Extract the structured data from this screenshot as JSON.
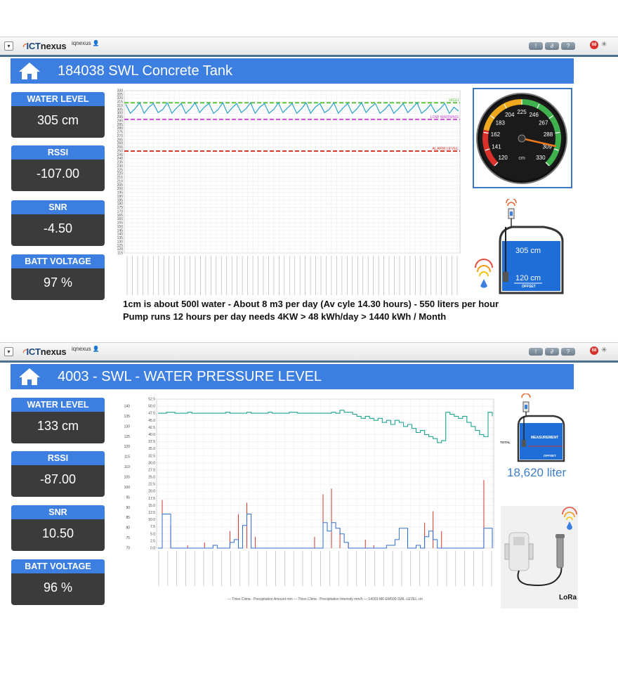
{
  "colors": {
    "accent": "#3d7fe0",
    "card_value_bg": "#3b3b3b",
    "toolbar_rule": "#4a6f8f",
    "high_line": "#5cc63f",
    "low_warning_line": "#c94cd1",
    "alarm_line": "#d93a2e",
    "level_series": "#2aa3c9",
    "teal_series": "#1fa590",
    "precip_amount": "#d23a2e",
    "precip_intensity": "#2e6fd1",
    "badge": "#d9302a"
  },
  "toolbar": {
    "logo_prefix": "ICT",
    "logo_suffix": "nexus",
    "username": "iqnexus",
    "dropdown_icon": "chevron-down-icon",
    "user_icon": "user-icon",
    "buttons": [
      {
        "label": "!",
        "icon": "alert-icon"
      },
      {
        "label": "",
        "icon": "link-icon"
      },
      {
        "label": "?",
        "icon": "help-icon"
      }
    ],
    "badge_count": "68",
    "spark_icon": "sparkle-icon"
  },
  "panel1": {
    "title": "184038 SWL Concrete Tank",
    "home_icon": "home-icon",
    "cards": [
      {
        "label": "WATER LEVEL",
        "value": "305 cm"
      },
      {
        "label": "RSSI",
        "value": "-107.00"
      },
      {
        "label": "SNR",
        "value": "-4.50"
      },
      {
        "label": "BATT VOLTAGE",
        "value": "97 %"
      }
    ],
    "note_line1": "1cm is about 500l water - About 8 m3 per day (Av cyle 14.30 hours) - 550 liters per hour",
    "note_line2": "Pump runs 12 hours per day needs 4KW > 48 kWh/day > 1440 kWh / Month",
    "gauge": {
      "value": 305,
      "min": 120,
      "max": 330,
      "unit": "cm",
      "ticks": [
        "120",
        "141",
        "162",
        "183",
        "204",
        "225",
        "246",
        "267",
        "288",
        "309",
        "330"
      ]
    },
    "tank": {
      "level_label": "305 cm",
      "offset_label": "120 cm",
      "offset_caption": "OFFSET"
    }
  },
  "chart_data": [
    {
      "type": "line",
      "yticks": [
        "115",
        "120",
        "125",
        "130",
        "135",
        "140",
        "145",
        "150",
        "155",
        "160",
        "165",
        "170",
        "175",
        "180",
        "185",
        "190",
        "195",
        "200",
        "205",
        "210",
        "215",
        "220",
        "225",
        "230",
        "235",
        "240",
        "245",
        "250",
        "255",
        "260",
        "265",
        "270",
        "275",
        "280",
        "285",
        "290",
        "295",
        "300",
        "305",
        "310",
        "315",
        "320",
        "325",
        "330"
      ],
      "ylim": [
        115,
        330
      ],
      "series": [
        {
          "name": "HIGH",
          "values": [
            314,
            314
          ]
        },
        {
          "name": "LOW WARNING",
          "values": [
            292,
            292
          ]
        },
        {
          "name": "ALARM LEVEL",
          "values": [
            250,
            250
          ]
        },
        {
          "values": [
            312,
            300,
            306,
            314,
            300,
            308,
            313,
            301,
            305,
            314,
            300,
            307,
            313,
            300,
            306,
            314,
            301,
            308,
            313,
            300,
            305,
            314,
            300,
            307,
            313,
            301,
            306,
            314,
            300,
            308,
            313,
            300,
            305,
            314,
            301,
            307,
            313,
            300,
            306,
            314,
            300,
            308,
            313,
            301,
            305,
            314,
            300,
            307,
            313,
            300,
            306,
            314,
            301,
            308,
            313,
            300,
            305,
            312,
            300,
            306,
            313,
            301,
            307,
            314,
            300,
            305,
            312,
            301,
            306,
            313,
            300,
            308,
            303
          ]
        }
      ],
      "grid": true,
      "xlabels_count": 64
    },
    {
      "type": "line",
      "legend": "— Thies Clima - Precipitation Amount mm  — Thies Clima - Precipitation Intensity mm/h  — 14003-M6-EM500-SWL-LEVEL cm",
      "y_left_ticks": [
        "70",
        "75",
        "80",
        "85",
        "90",
        "95",
        "100",
        "105",
        "110",
        "115",
        "120",
        "125",
        "130",
        "135",
        "140"
      ],
      "y_right_ticks": [
        "0.0",
        "2.5",
        "5.0",
        "7.5",
        "10.0",
        "12.5",
        "15.0",
        "17.5",
        "20.0",
        "22.5",
        "25.0",
        "27.5",
        "30.0",
        "32.5",
        "35.0",
        "37.5",
        "40.0",
        "42.5",
        "45.0",
        "47.5",
        "50.0",
        "52.5"
      ],
      "series": [
        {
          "name": "14003-M6-EM500-SWL-LEVEL cm",
          "values": [
            136.5,
            136.5,
            137,
            137,
            136.5,
            136.5,
            136.5,
            137,
            136.5,
            136.5,
            136.5,
            136.5,
            136.5,
            136.5,
            136.5,
            136.5,
            137,
            136.5,
            136.5,
            136.5,
            136.5,
            137,
            136.5,
            136.5,
            136.5,
            136.5,
            137,
            136.5,
            136.5,
            136.5,
            136.5,
            137,
            137,
            136.5,
            136.5,
            136.5,
            136.5,
            136.5,
            136.5,
            136.5,
            136.5,
            137,
            136.5,
            138,
            137,
            137,
            136,
            135,
            134,
            135,
            134,
            133,
            134,
            132,
            133,
            131,
            133,
            132,
            130,
            131,
            129,
            127,
            128,
            126,
            125,
            124,
            122,
            123,
            137,
            136,
            135,
            134,
            135,
            132,
            130,
            128,
            126,
            125,
            137,
            135
          ]
        },
        {
          "name": "Thies Clima - Precipitation Amount mm",
          "values": [
            0,
            17,
            0,
            8,
            0,
            0,
            0,
            1,
            0,
            0,
            0,
            2,
            0,
            0,
            0,
            0,
            0,
            6,
            0,
            12,
            0,
            16,
            0,
            4,
            0,
            0,
            0,
            0,
            0,
            0,
            0,
            0,
            0,
            0,
            0,
            0,
            0,
            4,
            0,
            19,
            0,
            21,
            0,
            7,
            0,
            2,
            0,
            0,
            0,
            3,
            0,
            1,
            0,
            0,
            0,
            0,
            0,
            0,
            0,
            0,
            0,
            0,
            0,
            9,
            0,
            13,
            0,
            6,
            0,
            0,
            0,
            0,
            0,
            0,
            0,
            0,
            0,
            24,
            0,
            0
          ]
        },
        {
          "name": "Thies Clima - Precipitation Intensity mm/h",
          "values": [
            0,
            12,
            12,
            0,
            0,
            0,
            0,
            0,
            0,
            0,
            0,
            0,
            0,
            1,
            0,
            0,
            0,
            2,
            3,
            0,
            8,
            12,
            0,
            0,
            0,
            0,
            0,
            0,
            0,
            0,
            0,
            0,
            0,
            0,
            0,
            0,
            0,
            0,
            0,
            9,
            6,
            9,
            7,
            5,
            2,
            0,
            0,
            0,
            0,
            0,
            0,
            0,
            0,
            0,
            1,
            1,
            3,
            7,
            7,
            0,
            0,
            1,
            0,
            4,
            6,
            3,
            0,
            0,
            0,
            0,
            0,
            0,
            0,
            0,
            0,
            0,
            0,
            7,
            7,
            0
          ]
        }
      ],
      "grid": true,
      "xlabels_count": 38
    }
  ],
  "panel2": {
    "title": "4003 - SWL - WATER PRESSURE LEVEL",
    "home_icon": "home-icon",
    "cards": [
      {
        "label": "WATER LEVEL",
        "value": "133 cm"
      },
      {
        "label": "RSSI",
        "value": "-87.00"
      },
      {
        "label": "SNR",
        "value": "10.50"
      },
      {
        "label": "BATT VOLTAGE",
        "value": "96 %"
      }
    ],
    "tank": {
      "measurement_caption": "MEASUREMENT",
      "total_caption": "TOTAL",
      "offset_caption": "OFFSET"
    },
    "liters": "18,620 liter",
    "lora_caption": "LoRa"
  }
}
